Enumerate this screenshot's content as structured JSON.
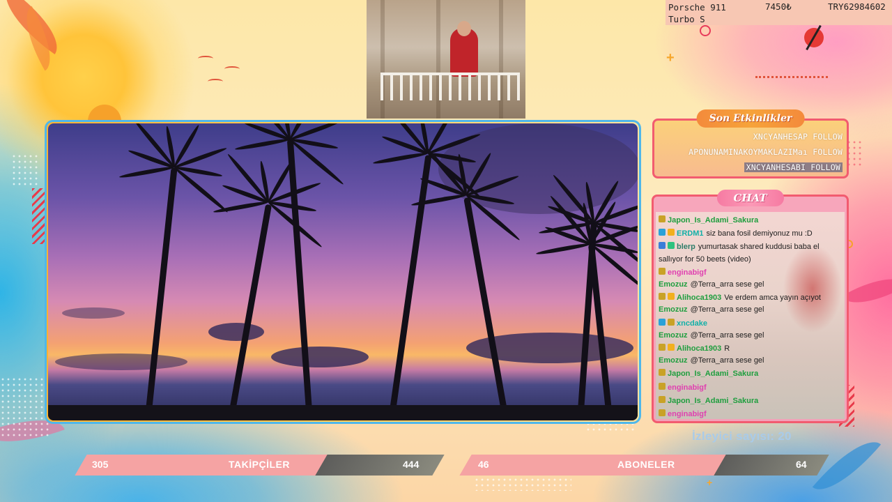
{
  "donation": {
    "item": "Porsche 911 Turbo S",
    "price": "7450₺",
    "code": "TRY62984602"
  },
  "events": {
    "title": "Son Etkinlikler",
    "items": [
      "XNCYANHESAP FOLLOW",
      "APONUNAMINAKOYMAKLAZIMaı FOLLOW",
      "XNCYANHESABI FOLLOW"
    ]
  },
  "chat": {
    "title": "CHAT",
    "messages": [
      {
        "user": "Japon_Is_Adami_Sakura",
        "text": "",
        "color": "u-green",
        "badges": [
          "#c9a227"
        ]
      },
      {
        "user": "ERDM1",
        "text": "siz bana fosil demiyonuz mu :D",
        "color": "u-teal",
        "badges": [
          "#2aa1d8",
          "#f2b01e"
        ]
      },
      {
        "user": "blerp",
        "text": "yumurtasak shared kuddusi baba el sallıyor for 50 beets (video)",
        "color": "u-blue",
        "badges": [
          "#3b7dd8",
          "#2ec27e"
        ]
      },
      {
        "user": "enginabigf",
        "text": "",
        "color": "u-pink",
        "badges": [
          "#c9a227"
        ]
      },
      {
        "user": "Emozuz",
        "text": "@Terra_arra sese gel",
        "color": "u-green",
        "badges": []
      },
      {
        "user": "Alihoca1903",
        "text": "Ve erdem amca yayın açıyot",
        "color": "u-green",
        "badges": [
          "#c9a227",
          "#f2b01e"
        ]
      },
      {
        "user": "Emozuz",
        "text": "@Terra_arra sese gel",
        "color": "u-green",
        "badges": []
      },
      {
        "user": "xncdake",
        "text": "",
        "color": "u-teal",
        "badges": [
          "#2aa1d8",
          "#c9a227"
        ]
      },
      {
        "user": "Emozuz",
        "text": "@Terra_arra sese gel",
        "color": "u-green",
        "badges": []
      },
      {
        "user": "Alihoca1903",
        "text": "R",
        "color": "u-green",
        "badges": [
          "#c9a227",
          "#f2b01e"
        ]
      },
      {
        "user": "Emozuz",
        "text": "@Terra_arra sese gel",
        "color": "u-green",
        "badges": []
      },
      {
        "user": "Japon_Is_Adami_Sakura",
        "text": "",
        "color": "u-green",
        "badges": [
          "#c9a227"
        ]
      },
      {
        "user": "enginabigf",
        "text": "",
        "color": "u-pink",
        "badges": [
          "#c9a227"
        ]
      },
      {
        "user": "Japon_Is_Adami_Sakura",
        "text": "",
        "color": "u-green",
        "badges": [
          "#c9a227"
        ]
      },
      {
        "user": "enginabigf",
        "text": "",
        "color": "u-pink",
        "badges": [
          "#c9a227"
        ]
      },
      {
        "user": "Japon_Is_Adami_Sakura",
        "text": "",
        "color": "u-green",
        "badges": [
          "#c9a227"
        ]
      }
    ]
  },
  "viewers": "İzleyici sayısı: 20",
  "followers": {
    "current": "305",
    "label": "TAKİPÇİLER",
    "goal": "444"
  },
  "subscribers": {
    "current": "46",
    "label": "ABONELER",
    "goal": "64"
  },
  "colors": {
    "accent": "#f25b6f",
    "frame": "#f9b233",
    "bar_pink": "#f5a3a3"
  }
}
